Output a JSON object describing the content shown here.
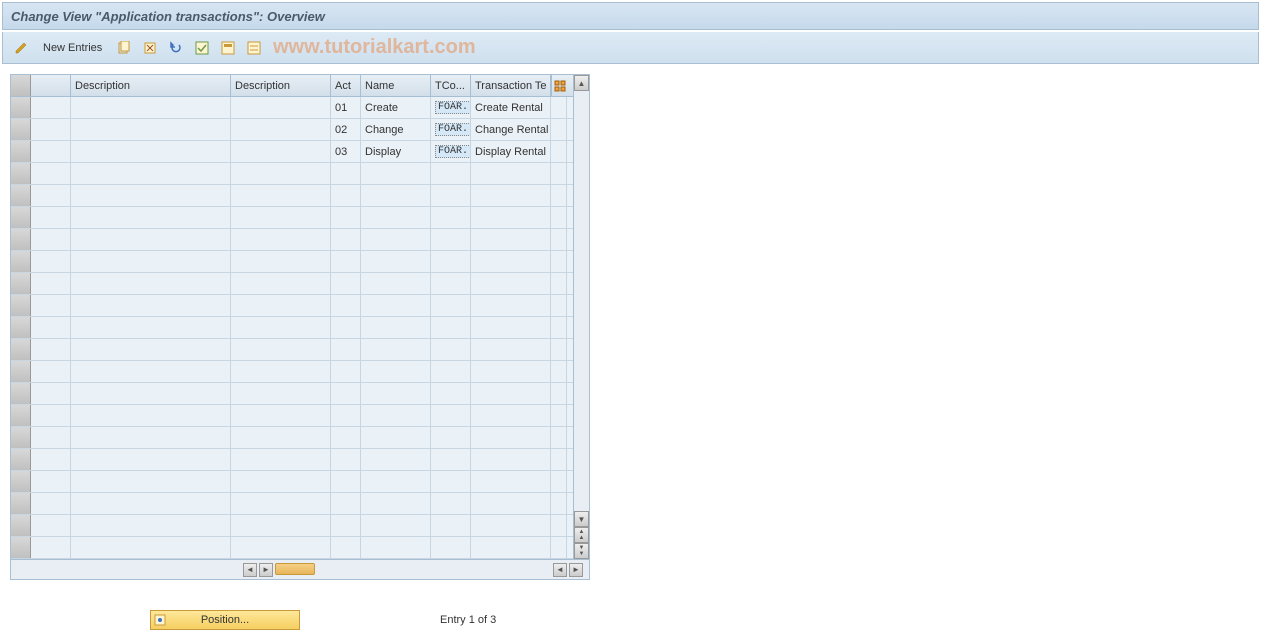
{
  "title": "Change View \"Application transactions\": Overview",
  "toolbar": {
    "new_entries_label": "New Entries"
  },
  "watermark": "www.tutorialkart.com",
  "table": {
    "headers": {
      "selector": "",
      "id1": "",
      "desc1": "Description",
      "desc2": "Description",
      "act": "Act",
      "name": "Name",
      "tcode": "TCo...",
      "trtext": "Transaction Te"
    },
    "rows": [
      {
        "id1": "",
        "desc1": "",
        "desc2": "",
        "act": "01",
        "name": "Create",
        "tcode": "FOAR..",
        "trtext": "Create Rental"
      },
      {
        "id1": "",
        "desc1": "",
        "desc2": "",
        "act": "02",
        "name": "Change",
        "tcode": "FOAR..",
        "trtext": "Change Rental"
      },
      {
        "id1": "",
        "desc1": "",
        "desc2": "",
        "act": "03",
        "name": "Display",
        "tcode": "FOAR..",
        "trtext": "Display Rental"
      }
    ],
    "empty_row_count": 18
  },
  "footer": {
    "position_label": "Position...",
    "entry_text": "Entry 1 of 3"
  }
}
